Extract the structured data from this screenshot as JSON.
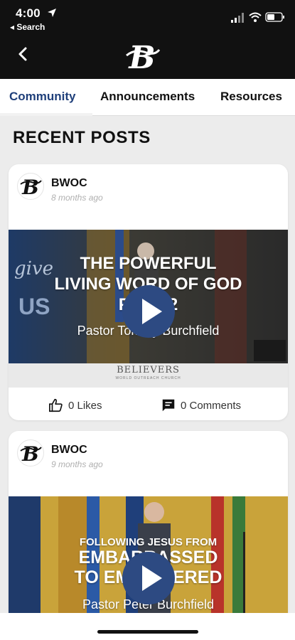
{
  "status_bar": {
    "time": "4:00",
    "back_label": "◂ Search"
  },
  "header": {
    "logo_icon": "believers-b-logo-icon",
    "back_icon": "chevron-left-icon"
  },
  "tabs": [
    {
      "label": "Community",
      "active": true
    },
    {
      "label": "Announcements",
      "active": false
    },
    {
      "label": "Resources",
      "active": false
    }
  ],
  "section_title": "RECENT POSTS",
  "posts": [
    {
      "author": "BWOC",
      "time_ago": "8 months ago",
      "video": {
        "title_line1": "THE POWERFUL",
        "title_line2": "LIVING WORD OF GOD",
        "title_line3": "PART 2",
        "speaker": "Pastor Tommy Burchfield",
        "brand": "BELIEVERS",
        "brand_sub": "WORLD OUTREACH CHURCH",
        "side_text": "give",
        "side_text2": "US"
      },
      "likes_label": "0 Likes",
      "comments_label": "0 Comments"
    },
    {
      "author": "BWOC",
      "time_ago": "9 months ago",
      "video": {
        "title_line1": "FOLLOWING JESUS FROM",
        "title_line2": "EMBARRASSED",
        "title_line3": "TO EMPOWERED",
        "speaker": "Pastor Peter Burchfield"
      }
    }
  ],
  "colors": {
    "accent": "#1f3f7a",
    "play_button": "#2d4a82",
    "topbar": "#111111"
  }
}
